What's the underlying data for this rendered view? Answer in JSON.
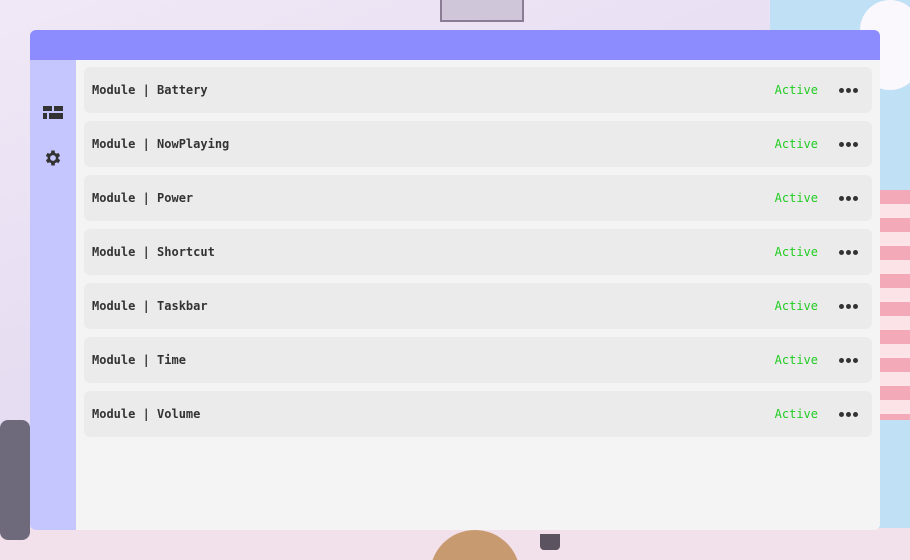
{
  "window": {
    "titlebar_color": "#8c8cfe",
    "sidebar_color": "#c6c6fe"
  },
  "sidebar": {
    "items": [
      {
        "icon": "dashboard-icon"
      },
      {
        "icon": "gear-icon"
      }
    ],
    "close_icon": "close-icon",
    "close_color": "#dd0000"
  },
  "modules": {
    "status_color": "#22cc22",
    "items": [
      {
        "name": "Module | Battery",
        "status": "Active"
      },
      {
        "name": "Module | NowPlaying",
        "status": "Active"
      },
      {
        "name": "Module | Power",
        "status": "Active"
      },
      {
        "name": "Module | Shortcut",
        "status": "Active"
      },
      {
        "name": "Module | Taskbar",
        "status": "Active"
      },
      {
        "name": "Module | Time",
        "status": "Active"
      },
      {
        "name": "Module | Volume",
        "status": "Active"
      }
    ],
    "more_icon": "more-horizontal-icon"
  }
}
